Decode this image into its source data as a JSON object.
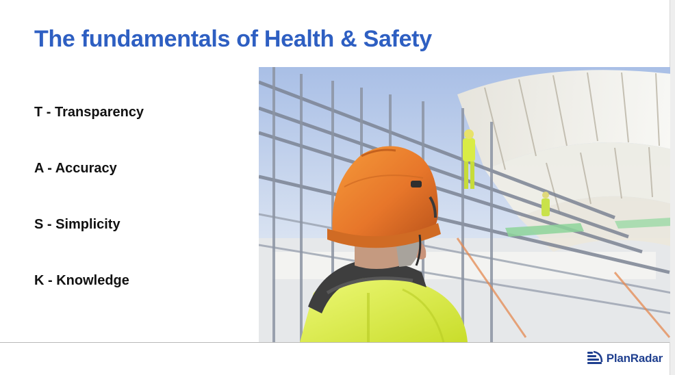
{
  "slide": {
    "title": "The fundamentals of Health & Safety",
    "points": [
      "T - Transparency",
      "A - Accuracy",
      "S - Simplicity",
      "K - Knowledge"
    ],
    "brand": "PlanRadar",
    "colors": {
      "title": "#2e5fc2",
      "brand": "#1f3f8f",
      "text": "#111111"
    }
  }
}
